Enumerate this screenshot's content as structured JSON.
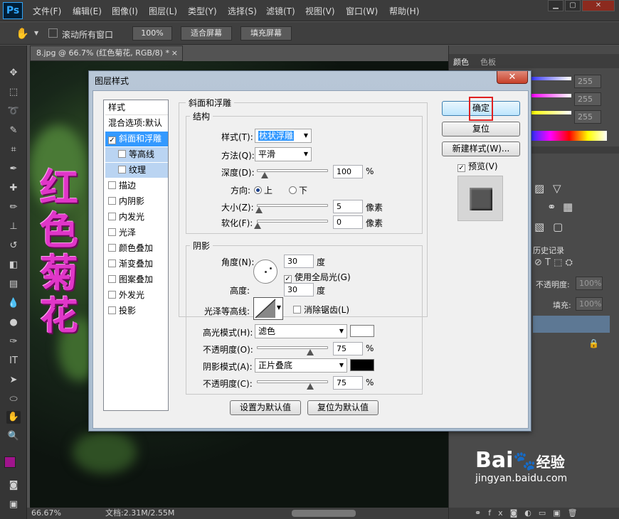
{
  "app": {
    "logo": "Ps"
  },
  "menu": [
    "文件(F)",
    "编辑(E)",
    "图像(I)",
    "图层(L)",
    "类型(Y)",
    "选择(S)",
    "滤镜(T)",
    "视图(V)",
    "窗口(W)",
    "帮助(H)"
  ],
  "options": {
    "scroll_all_label": "滚动所有窗口",
    "zoom_100": "100%",
    "fit_screen": "适合屏幕",
    "fill_screen": "填充屏幕"
  },
  "document": {
    "tab_label": "8.jpg @ 66.7% (红色菊花, RGB/8) *",
    "close": "×",
    "artwork_text": "红色菊花"
  },
  "status": {
    "zoom": "66.67%",
    "doc_size": "文档:2.31M/2.55M"
  },
  "right_panel": {
    "color_tab": "颜色",
    "swatch_tab": "色板",
    "rgb_values": [
      "255",
      "255",
      "255"
    ],
    "history_tab": "历史记录",
    "opacity_label": "不透明度:",
    "opacity_value": "100%",
    "fill_label": "填充:",
    "fill_value": "100%"
  },
  "dialog": {
    "title": "图层样式",
    "close": "✕",
    "styles_header": "样式",
    "blend_options": "混合选项:默认",
    "style_items": [
      {
        "label": "斜面和浮雕",
        "checked": true,
        "selected": true,
        "indent": false
      },
      {
        "label": "等高线",
        "checked": false,
        "selected": false,
        "indent": true
      },
      {
        "label": "纹理",
        "checked": false,
        "selected": false,
        "indent": true
      },
      {
        "label": "描边",
        "checked": false,
        "selected": false,
        "indent": false
      },
      {
        "label": "内阴影",
        "checked": false,
        "selected": false,
        "indent": false
      },
      {
        "label": "内发光",
        "checked": false,
        "selected": false,
        "indent": false
      },
      {
        "label": "光泽",
        "checked": false,
        "selected": false,
        "indent": false
      },
      {
        "label": "颜色叠加",
        "checked": false,
        "selected": false,
        "indent": false
      },
      {
        "label": "渐变叠加",
        "checked": false,
        "selected": false,
        "indent": false
      },
      {
        "label": "图案叠加",
        "checked": false,
        "selected": false,
        "indent": false
      },
      {
        "label": "外发光",
        "checked": false,
        "selected": false,
        "indent": false
      },
      {
        "label": "投影",
        "checked": false,
        "selected": false,
        "indent": false
      }
    ],
    "bevel": {
      "section_title": "斜面和浮雕",
      "structure_title": "结构",
      "style_label": "样式(T):",
      "style_value": "枕状浮雕",
      "method_label": "方法(Q):",
      "method_value": "平滑",
      "depth_label": "深度(D):",
      "depth_value": "100",
      "depth_unit": "%",
      "depth_level": 0.1,
      "direction_label": "方向:",
      "dir_up": "上",
      "dir_down": "下",
      "size_label": "大小(Z):",
      "size_value": "5",
      "size_unit": "像素",
      "size_level": 0.02,
      "soften_label": "软化(F):",
      "soften_value": "0",
      "soften_unit": "像素",
      "soften_level": 0.0
    },
    "shading": {
      "title": "阴影",
      "angle_label": "角度(N):",
      "angle_value": "30",
      "angle_unit": "度",
      "global_light": "使用全局光(G)",
      "altitude_label": "高度:",
      "altitude_value": "30",
      "altitude_unit": "度",
      "gloss_label": "光泽等高线:",
      "antialias": "消除锯齿(L)",
      "highlight_label": "高光模式(H):",
      "highlight_value": "滤色",
      "highlight_color": "#ffffff",
      "hl_opacity_label": "不透明度(O):",
      "hl_opacity_value": "75",
      "hl_opacity_unit": "%",
      "hl_opacity_level": 0.75,
      "shadow_label": "阴影模式(A):",
      "shadow_value": "正片叠底",
      "shadow_color": "#000000",
      "sh_opacity_label": "不透明度(C):",
      "sh_opacity_value": "75",
      "sh_opacity_unit": "%",
      "sh_opacity_level": 0.75
    },
    "make_default": "设置为默认值",
    "reset_default": "复位为默认值",
    "ok": "确定",
    "reset": "复位",
    "new_style": "新建样式(W)...",
    "preview": "预览(V)"
  },
  "watermark": {
    "brand": "Bai",
    "brand2": "经验",
    "url": "jingyan.baidu.com"
  }
}
